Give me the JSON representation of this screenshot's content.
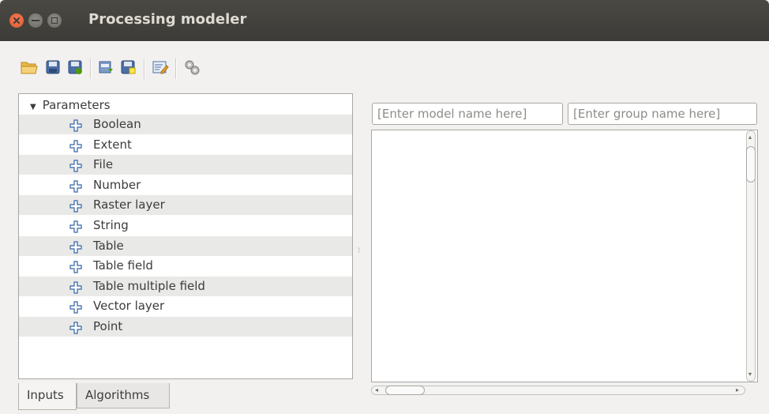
{
  "window": {
    "title": "Processing modeler"
  },
  "toolbar": {
    "buttons": [
      {
        "name": "open-model",
        "icon": "folder-open-icon"
      },
      {
        "name": "save-model",
        "icon": "floppy-disk-icon"
      },
      {
        "name": "save-model-as",
        "icon": "floppy-disk-edit-icon"
      },
      {
        "name": "export-image",
        "icon": "export-image-icon"
      },
      {
        "name": "export-python",
        "icon": "export-script-icon"
      },
      {
        "name": "edit-help",
        "icon": "edit-help-icon"
      },
      {
        "name": "run-model",
        "icon": "gears-icon"
      }
    ]
  },
  "inputs_tree": {
    "root_label": "Parameters",
    "items": [
      {
        "label": "Boolean"
      },
      {
        "label": "Extent"
      },
      {
        "label": "File"
      },
      {
        "label": "Number"
      },
      {
        "label": "Raster layer"
      },
      {
        "label": "String"
      },
      {
        "label": "Table"
      },
      {
        "label": "Table field"
      },
      {
        "label": "Table multiple field"
      },
      {
        "label": "Vector layer"
      },
      {
        "label": "Point"
      }
    ]
  },
  "tabs": [
    {
      "label": "Inputs",
      "active": true
    },
    {
      "label": "Algorithms",
      "active": false
    }
  ],
  "model_name": {
    "value": "",
    "placeholder": "[Enter model name here]"
  },
  "group_name": {
    "value": "",
    "placeholder": "[Enter group name here]"
  },
  "colors": {
    "titlebar": "#3c3b37",
    "close_button": "#e05a2b",
    "plus_icon": "#3465a4"
  }
}
